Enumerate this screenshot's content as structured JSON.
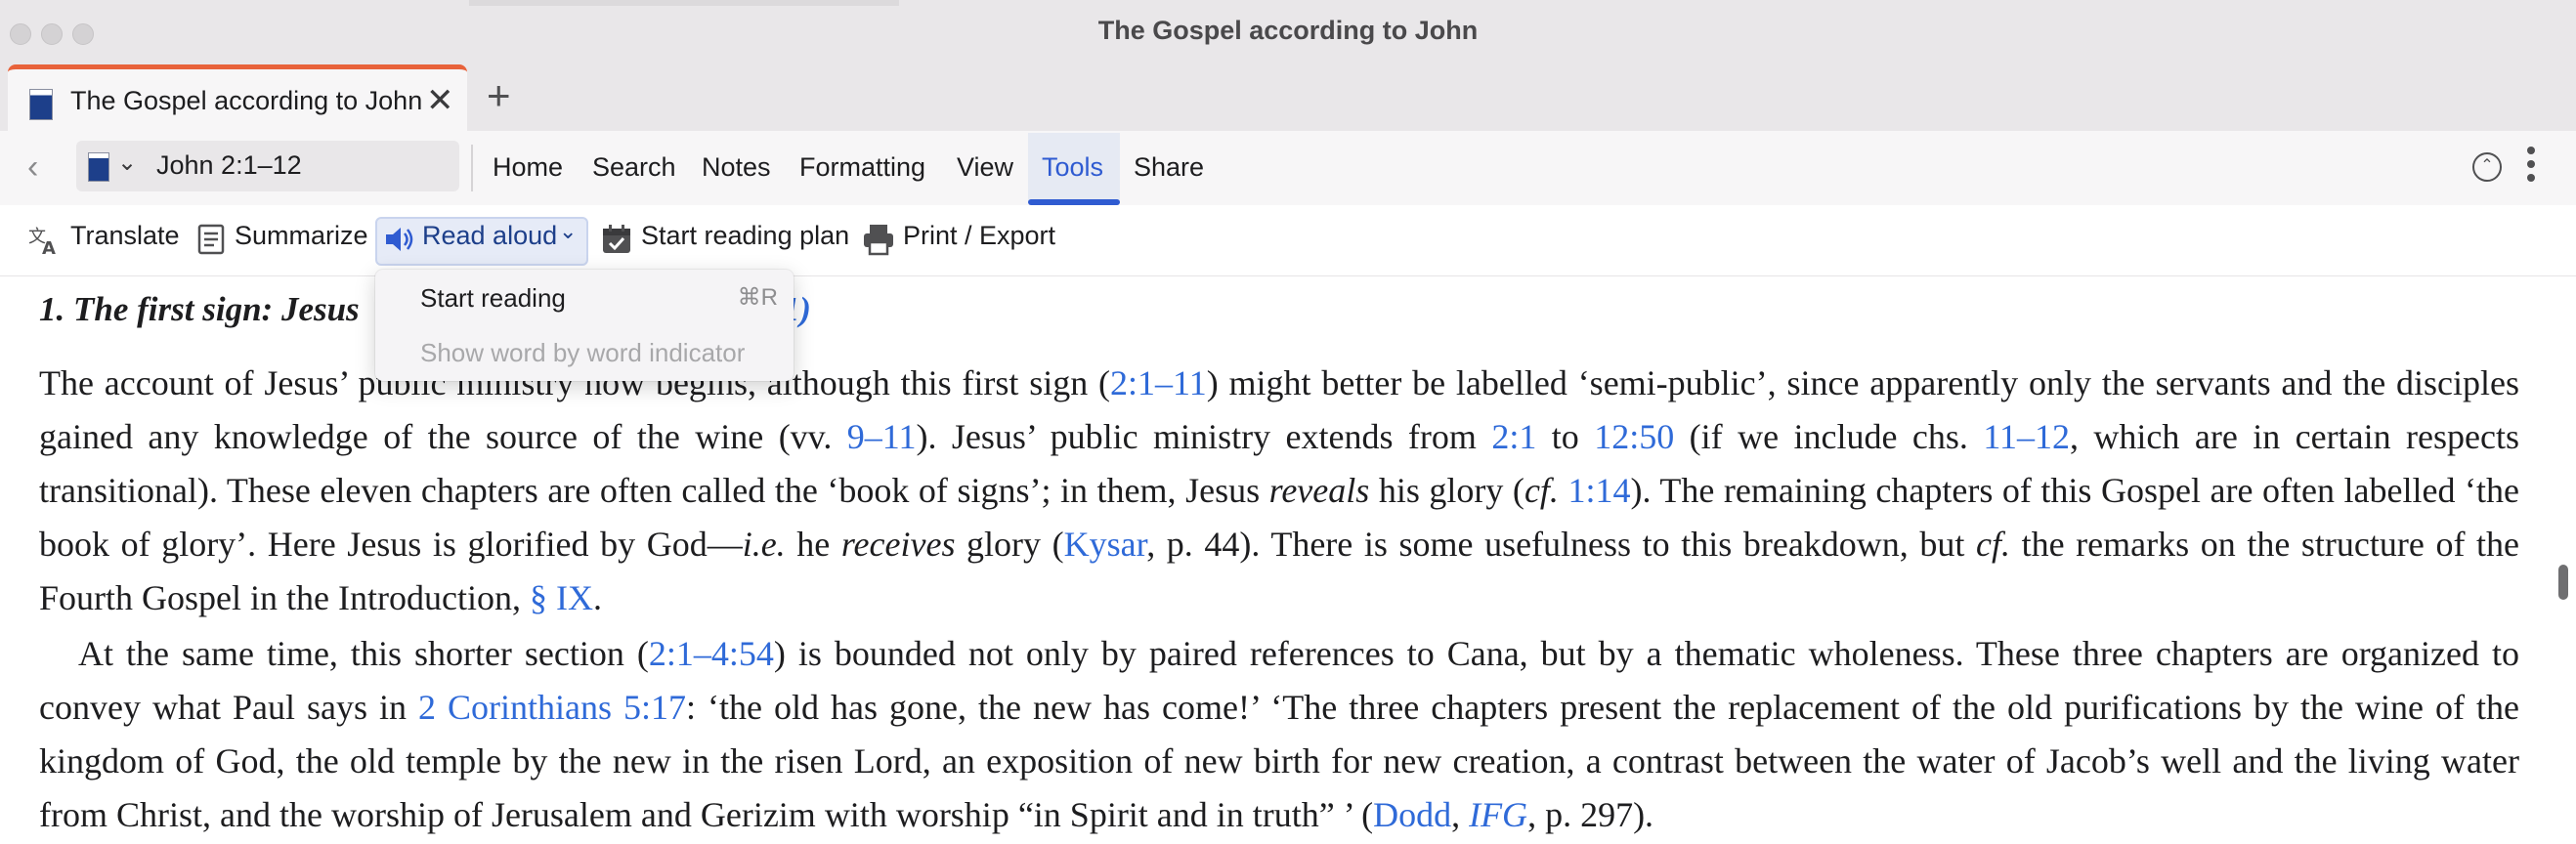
{
  "window": {
    "title": "The Gospel according to John"
  },
  "tab": {
    "title": "The Gospel according to John",
    "close_glyph": "✕",
    "new_tab_glyph": "+"
  },
  "nav": {
    "back_glyph": "‹",
    "reference": "John 2:1–12",
    "menu": [
      "Home",
      "Search",
      "Notes",
      "Formatting",
      "View",
      "Tools",
      "Share"
    ],
    "active_menu": "Tools"
  },
  "toolbar": {
    "translate": "Translate",
    "summarize": "Summarize",
    "read_aloud": "Read aloud",
    "reading_plan": "Start reading plan",
    "print_export": "Print / Export"
  },
  "dropdown": {
    "start_reading": "Start reading",
    "start_reading_shortcut": "⌘R",
    "word_indicator": "Show word by word indicator"
  },
  "content": {
    "heading_number": "1.",
    "heading_visible": "The first sign: Jesus",
    "heading_tail": "11)",
    "p1": [
      {
        "t": "The account of Jesus’ public ministry now begins, although this first sign ("
      },
      {
        "t": "2:1–11",
        "link": true
      },
      {
        "t": ") might better be labelled ‘semi-public’, since apparently only the servants and the disciples gained any knowledge of the source of the wine (vv. "
      },
      {
        "t": "9–11",
        "link": true
      },
      {
        "t": "). Jesus’ public ministry extends from "
      },
      {
        "t": "2:1",
        "link": true
      },
      {
        "t": " to "
      },
      {
        "t": "12:50",
        "link": true
      },
      {
        "t": " (if we include chs. "
      },
      {
        "t": "11–12",
        "link": true
      },
      {
        "t": ", which are in certain respects transitional). These eleven chapters are often called the ‘book of signs’; in them, Jesus "
      },
      {
        "t": "reveals",
        "italic": true
      },
      {
        "t": " his glory ("
      },
      {
        "t": "cf.",
        "italic": true
      },
      {
        "t": " "
      },
      {
        "t": "1:14",
        "link": true
      },
      {
        "t": "). The remaining chapters of this Gospel are often labelled ‘the book of glory’. Here Jesus is glorified by God—"
      },
      {
        "t": "i.e.",
        "italic": true
      },
      {
        "t": " he "
      },
      {
        "t": "receives",
        "italic": true
      },
      {
        "t": " glory ("
      },
      {
        "t": "Kysar",
        "link": true
      },
      {
        "t": ", p. 44). There is some usefulness to this breakdown, but "
      },
      {
        "t": "cf.",
        "italic": true
      },
      {
        "t": " the remarks on the structure of the Fourth Gospel in the Introduction, "
      },
      {
        "t": "§ IX",
        "link": true
      },
      {
        "t": "."
      }
    ],
    "p2": [
      {
        "t": "At the same time, this shorter section ("
      },
      {
        "t": "2:1–4:54",
        "link": true
      },
      {
        "t": ") is bounded not only by paired references to Cana, but by a thematic wholeness. These three chapters are organized to convey what Paul says in "
      },
      {
        "t": "2 Corinthians 5:17",
        "link": true
      },
      {
        "t": ": ‘the old has gone, the new has come!’ ‘The three chapters present the replacement of the old purifications by the wine of the kingdom of God, the old temple by the new in the risen Lord, an exposition of new birth for new creation, a contrast between the water of Jacob’s well and the living water from Christ, and the worship of Jerusalem and Gerizim with worship “in Spirit and in truth” ’ ("
      },
      {
        "t": "Dodd",
        "link": true
      },
      {
        "t": ", "
      },
      {
        "t": "IFG",
        "link": true,
        "italic": true
      },
      {
        "t": ", p. 297)."
      }
    ]
  },
  "colors": {
    "link": "#2f6ad8",
    "accent_tab": "#e8623a",
    "active_underline": "#2f5bd1"
  },
  "icons": [
    "translate-icon",
    "summarize-icon",
    "speaker-icon",
    "calendar-icon",
    "printer-icon",
    "book-icon",
    "collapse-icon",
    "more-icon"
  ]
}
